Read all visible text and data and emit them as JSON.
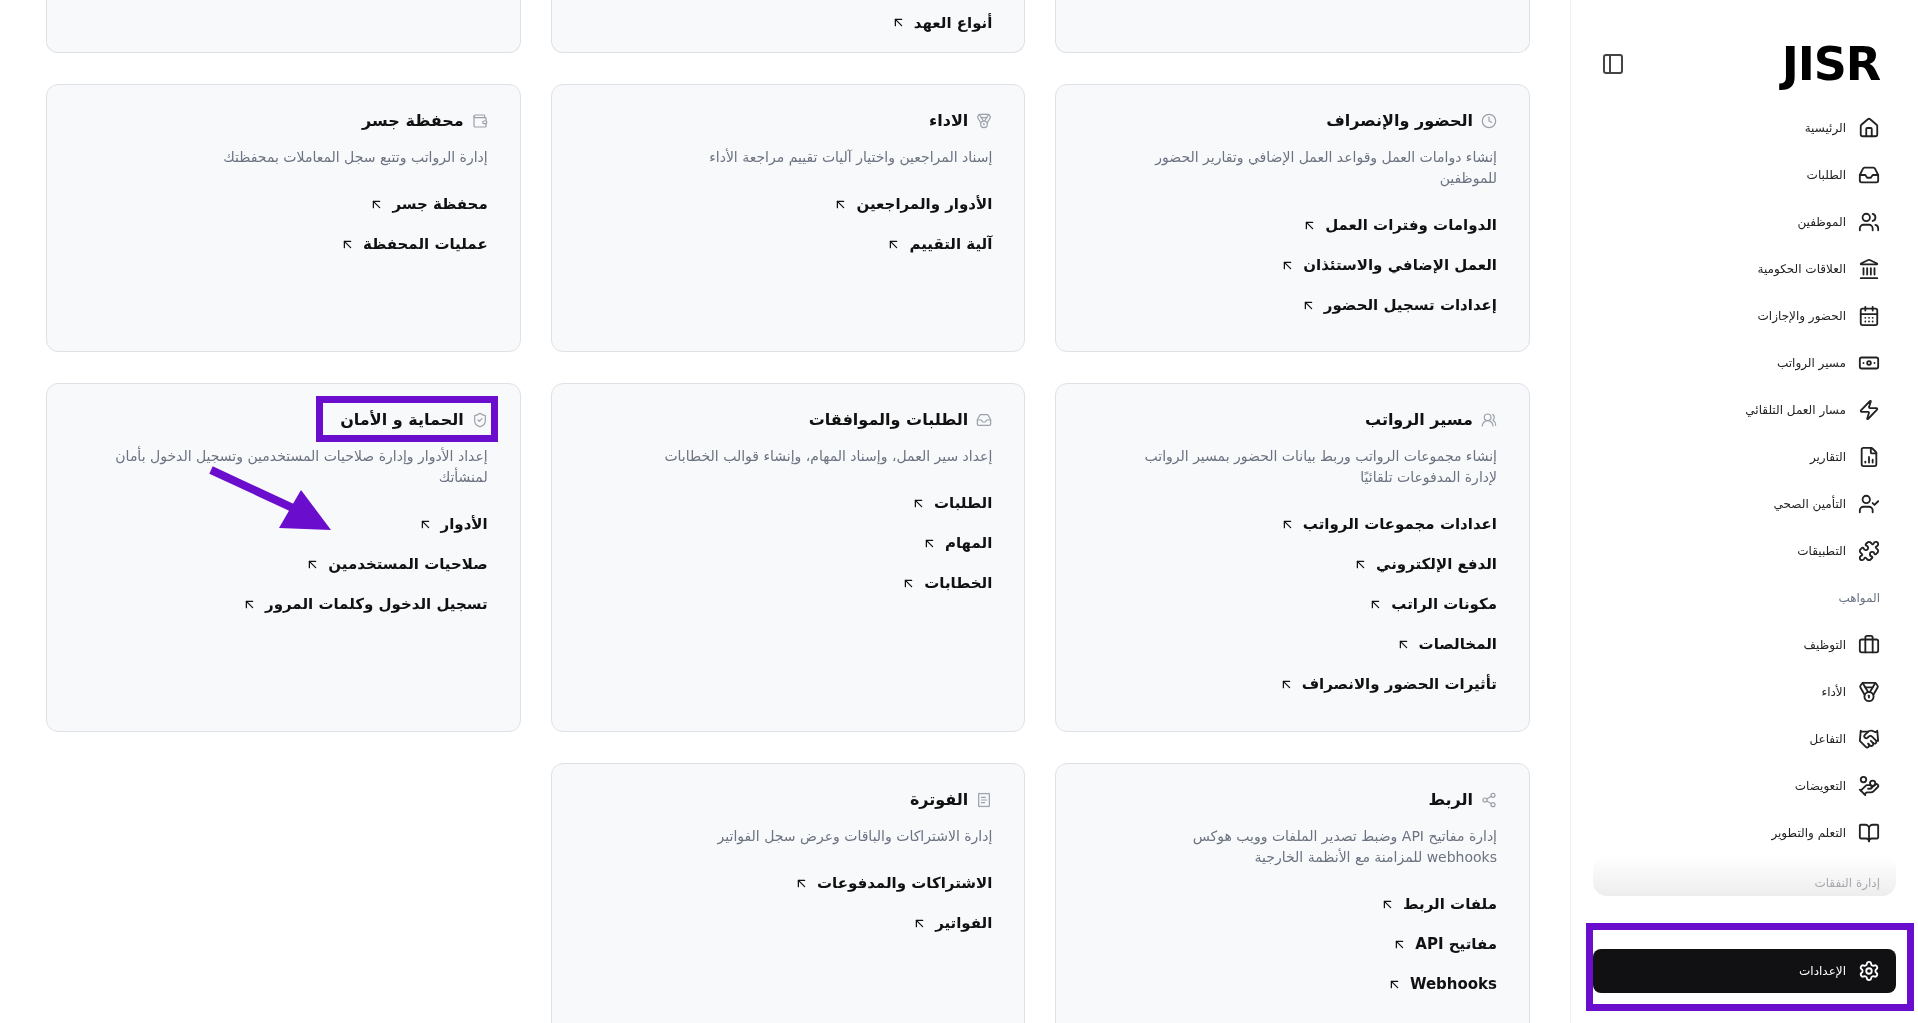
{
  "sidebar": {
    "logo": "JISR",
    "items": [
      {
        "kind": "item",
        "label": "الرئيسية",
        "selected": false
      },
      {
        "kind": "item",
        "label": "الطلبات",
        "selected": false
      },
      {
        "kind": "item",
        "label": "الموظفين",
        "selected": false
      },
      {
        "kind": "item",
        "label": "العلاقات الحكومية",
        "selected": false
      },
      {
        "kind": "item",
        "label": "الحضور والإجازات",
        "selected": false
      },
      {
        "kind": "item",
        "label": "مسير الرواتب",
        "selected": false
      },
      {
        "kind": "item",
        "label": "مسار العمل التلقائي",
        "selected": false
      },
      {
        "kind": "item",
        "label": "التقارير",
        "selected": false
      },
      {
        "kind": "item",
        "label": "التأمين الصحي",
        "selected": false
      },
      {
        "kind": "item",
        "label": "التطبيقات",
        "selected": false
      },
      {
        "kind": "section",
        "label": "المواهب"
      },
      {
        "kind": "item",
        "label": "التوظيف",
        "selected": false
      },
      {
        "kind": "item",
        "label": "الأداء",
        "selected": false
      },
      {
        "kind": "item",
        "label": "التفاعل",
        "selected": false
      },
      {
        "kind": "item",
        "label": "التعويضات",
        "selected": false
      },
      {
        "kind": "item",
        "label": "التعلم والتطوير",
        "selected": false
      },
      {
        "kind": "faded",
        "label": "إدارة النفقات"
      }
    ],
    "settings": {
      "label": "الإعدادات",
      "selected": true,
      "highlighted": true
    }
  },
  "cards": [
    {
      "kind": "cut"
    },
    {
      "kind": "cut",
      "links": [
        "أنواع العهد"
      ]
    },
    {
      "kind": "cut"
    },
    {
      "kind": "full",
      "title": "الحضور والإنصراف",
      "description": "إنشاء دوامات العمل وقواعد العمل الإضافي وتقارير الحضور للموظفين",
      "links": [
        "الدوامات وفترات العمل",
        "العمل الإضافي والاستئذان",
        "إعدادات تسجيل الحضور"
      ],
      "highlighted": false
    },
    {
      "kind": "full",
      "title": "الاداء",
      "description": "إسناد المراجعين واختيار آليات تقييم مراجعة الأداء",
      "links": [
        "الأدوار والمراجعين",
        "آلية التقييم"
      ],
      "highlighted": false
    },
    {
      "kind": "full",
      "title": "محفظة جسر",
      "description": "إدارة الرواتب وتتبع سجل المعاملات بمحفظتك",
      "links": [
        "محفظة جسر",
        "عمليات المحفظة"
      ],
      "highlighted": false
    },
    {
      "kind": "full",
      "title": "مسير الرواتب",
      "description": "إنشاء مجموعات الرواتب وربط بيانات الحضور بمسير الرواتب لإدارة المدفوعات تلقائيًا",
      "links": [
        "اعدادات مجموعات الرواتب",
        "الدفع الإلكتروني",
        "مكونات الراتب",
        "المخالصات",
        "تأثيرات الحضور والانصراف"
      ],
      "highlighted": false
    },
    {
      "kind": "full",
      "title": "الطلبات والموافقات",
      "description": "إعداد سير العمل، وإسناد المهام، وإنشاء قوالب الخطابات",
      "links": [
        "الطلبات",
        "المهام",
        "الخطابات"
      ],
      "highlighted": false
    },
    {
      "kind": "full",
      "title": "الحماية و الأمان",
      "description": "إعداد الأدوار وإدارة صلاحيات المستخدمين وتسجيل الدخول بأمان لمنشأتك",
      "links": [
        "الأدوار",
        "صلاحيات المستخدمين",
        "تسجيل الدخول وكلمات المرور"
      ],
      "highlighted": true
    },
    {
      "kind": "full",
      "title": "الربط",
      "description": "إدارة مفاتيح API وضبط تصدير الملفات وويب هوكس webhooks للمزامنة مع الأنظمة الخارجية",
      "links": [
        "ملفات الربط",
        "مفاتيح API",
        "Webhooks"
      ],
      "highlighted": false
    },
    {
      "kind": "full",
      "title": "الفوترة",
      "description": "إدارة الاشتراكات والباقات وعرض سجل الفواتير",
      "links": [
        "الاشتراكات والمدفوعات",
        "الفواتير"
      ],
      "highlighted": false
    }
  ]
}
